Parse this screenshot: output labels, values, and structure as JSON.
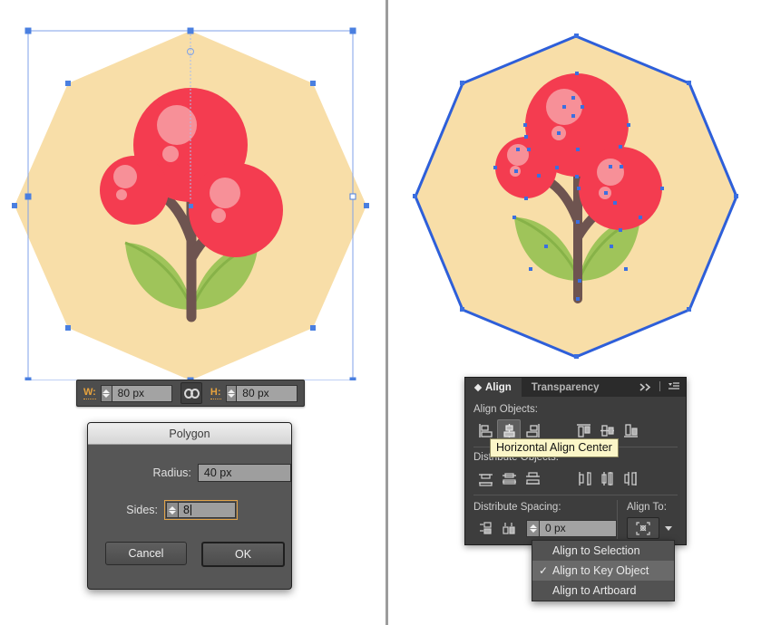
{
  "app": "Adobe Illustrator",
  "canvas": {
    "left_panel_name": "artwork-before-align",
    "right_panel_name": "artwork-after-align"
  },
  "artwork": {
    "description": "Flat illustration of a berry plant on an octagon background",
    "colors": {
      "octagon_fill": "#F8DEA8",
      "berry_red": "#F43C50",
      "berry_highlight": "#F79098",
      "stem_brown": "#6E5450",
      "leaf_green": "#9FC45A",
      "leaf_vein": "#87B248",
      "selection_blue": "#4A7FE0",
      "path_stroke_blue": "#2E5FD9"
    }
  },
  "transform_bar": {
    "width_label": "W:",
    "width_value": "80 px",
    "link_icon": "link-icon",
    "height_label": "H:",
    "height_value": "80 px"
  },
  "polygon_dialog": {
    "title": "Polygon",
    "radius_label": "Radius:",
    "radius_value": "40 px",
    "sides_label": "Sides:",
    "sides_value": "8",
    "cancel_label": "Cancel",
    "ok_label": "OK"
  },
  "align_panel": {
    "tabs": [
      {
        "label": "Align",
        "active": true
      },
      {
        "label": "Transparency",
        "active": false
      }
    ],
    "collapse_icon": "double-chevron-right-icon",
    "menu_icon": "panel-menu-icon",
    "align_objects_label": "Align Objects:",
    "align_objects_buttons": [
      {
        "name": "horizontal-align-left",
        "active": false
      },
      {
        "name": "horizontal-align-center",
        "active": true
      },
      {
        "name": "horizontal-align-right",
        "active": false
      },
      {
        "name": "vertical-align-top",
        "active": false
      },
      {
        "name": "vertical-align-center",
        "active": false
      },
      {
        "name": "vertical-align-bottom",
        "active": false
      }
    ],
    "distribute_objects_label": "Distribute Objects:",
    "distribute_objects_buttons": [
      {
        "name": "vertical-distribute-top",
        "active": false
      },
      {
        "name": "vertical-distribute-center",
        "active": false
      },
      {
        "name": "vertical-distribute-bottom",
        "active": false
      },
      {
        "name": "horizontal-distribute-left",
        "active": false
      },
      {
        "name": "horizontal-distribute-center",
        "active": false
      },
      {
        "name": "horizontal-distribute-right",
        "active": false
      }
    ],
    "distribute_spacing_label": "Distribute Spacing:",
    "distribute_spacing_buttons": [
      {
        "name": "vertical-distribute-space",
        "active": false
      },
      {
        "name": "horizontal-distribute-space",
        "active": false
      }
    ],
    "spacing_value": "0 px",
    "align_to_label": "Align To:",
    "align_to_icon": "align-to-key-object-icon"
  },
  "tooltip": {
    "text": "Horizontal Align Center"
  },
  "align_to_menu": {
    "items": [
      {
        "label": "Align to Selection",
        "checked": false,
        "selected": false
      },
      {
        "label": "Align to Key Object",
        "checked": true,
        "selected": true
      },
      {
        "label": "Align to Artboard",
        "checked": false,
        "selected": false
      }
    ],
    "check_glyph": "✓"
  }
}
